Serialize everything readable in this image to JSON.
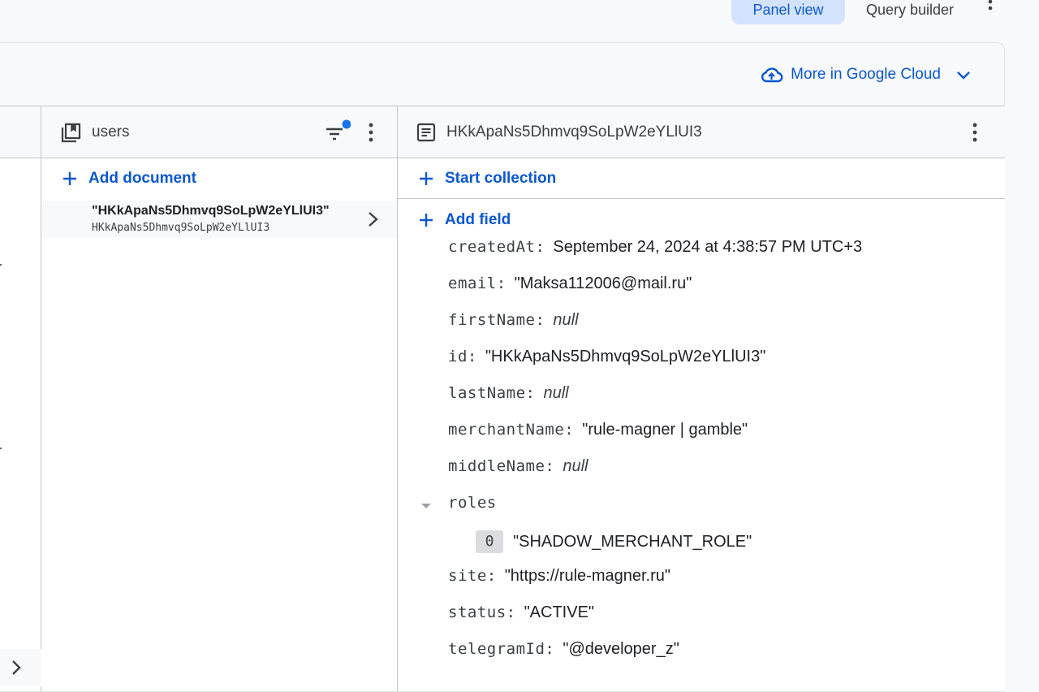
{
  "view_toggle": {
    "panel_view_label": "Panel view",
    "query_builder_label": "Query builder"
  },
  "toolbar": {
    "gcloud_label": "More in Google Cloud"
  },
  "collection": {
    "name": "users",
    "add_document_label": "Add document",
    "documents": [
      {
        "title": "\"HKkApaNs5Dhmvq9SoLpW2eYLlUI3\"",
        "id": "HKkApaNs5Dhmvq9SoLpW2eYLlUI3"
      }
    ]
  },
  "document": {
    "id": "HKkApaNs5Dhmvq9SoLpW2eYLlUI3",
    "start_collection_label": "Start collection",
    "add_field_label": "Add field",
    "fields": [
      {
        "key": "createdAt:",
        "value": "September 24, 2024 at 4:38:57 PM UTC+3",
        "is_null": false
      },
      {
        "key": "email:",
        "value": "\"Maksa112006@mail.ru\"",
        "is_null": false
      },
      {
        "key": "firstName:",
        "value": "null",
        "is_null": true
      },
      {
        "key": "id:",
        "value": "\"HKkApaNs5Dhmvq9SoLpW2eYLlUI3\"",
        "is_null": false
      },
      {
        "key": "lastName:",
        "value": "null",
        "is_null": true
      },
      {
        "key": "merchantName:",
        "value": "\"rule-magner | gamble\"",
        "is_null": false
      },
      {
        "key": "middleName:",
        "value": "null",
        "is_null": true
      }
    ],
    "roles": {
      "key": "roles",
      "items": [
        {
          "index": "0",
          "value": "\"SHADOW_MERCHANT_ROLE\""
        }
      ]
    },
    "fields_after": [
      {
        "key": "site:",
        "value": "\"https://rule-magner.ru\""
      },
      {
        "key": "status:",
        "value": "\"ACTIVE\""
      },
      {
        "key": "telegramId:",
        "value": "\"@developer_z\""
      }
    ]
  },
  "colors": {
    "accent": "#0b57d0",
    "accent_bg": "#d3e3fd",
    "filter_dot": "#1a73e8",
    "divider": "#c4c7c5"
  },
  "icons": {
    "cloud": "cloud-icon",
    "chevron_down": "chevron-down-icon",
    "collection": "collection-icon",
    "filter": "filter-icon",
    "more": "more-vert-icon",
    "document": "document-icon",
    "add": "add-icon",
    "chevron_right": "chevron-right-icon",
    "caret": "caret-down-icon"
  }
}
